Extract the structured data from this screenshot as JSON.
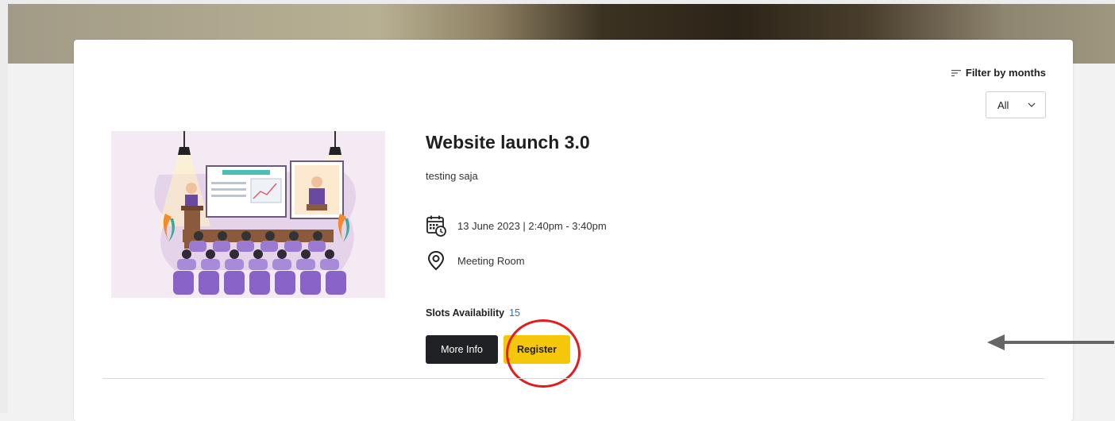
{
  "filter": {
    "label": "Filter by months",
    "selected": "All",
    "icon": "filter-lines-icon"
  },
  "event": {
    "title": "Website launch 3.0",
    "description": "testing saja",
    "datetime": "13 June 2023 | 2:40pm - 3:40pm",
    "location": "Meeting Room",
    "slots_label": "Slots Availability",
    "slots_count": "15",
    "more_info_label": "More Info",
    "register_label": "Register"
  },
  "colors": {
    "register_bg": "#f5c70b",
    "more_info_bg": "#202124",
    "annotation": "#e11d1d",
    "slots_count": "#2d6cc8"
  }
}
